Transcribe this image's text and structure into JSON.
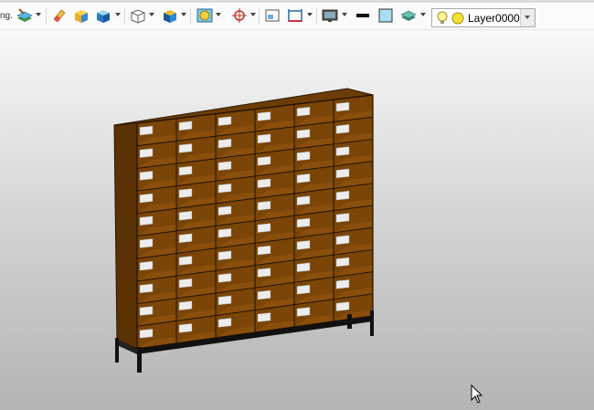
{
  "toolbar": {
    "cut_label_fragment": "ng.",
    "tools": [
      {
        "name": "layers-tool",
        "icon": "layers-icon"
      },
      {
        "name": "eraser-tool",
        "icon": "eraser-icon"
      },
      {
        "name": "material-tool",
        "icon": "box-material-icon"
      },
      {
        "name": "solid-view-tool",
        "icon": "solid-cube-icon"
      },
      {
        "name": "wireframe-view-tool",
        "icon": "wire-cube-icon"
      },
      {
        "name": "view-orientation-tool",
        "icon": "view-cube-icon"
      },
      {
        "name": "render-tool",
        "icon": "render-icon"
      },
      {
        "name": "snap-tool",
        "icon": "crosshair-icon"
      },
      {
        "name": "frame-tool",
        "icon": "frame-icon"
      },
      {
        "name": "dimension-tool",
        "icon": "dimension-icon"
      },
      {
        "name": "display-tool",
        "icon": "monitor-icon"
      },
      {
        "name": "line-color-tool",
        "icon": "black-line-icon"
      },
      {
        "name": "fill-color-tool",
        "icon": "light-blue-fill-icon"
      },
      {
        "name": "layer-stack-tool",
        "icon": "layer-stack-icon"
      }
    ],
    "layer_selector": {
      "value": "Layer0000"
    }
  },
  "colors": {
    "wood_front": "#7a4506",
    "wood_side": "#5a3203",
    "wood_top": "#6b3c05",
    "shelf": "#8a4f0c",
    "label": "#ececec",
    "frame": "#111111"
  },
  "viewport": {
    "object": "pigeonhole-cabinet",
    "columns": 6,
    "rows": 10
  }
}
